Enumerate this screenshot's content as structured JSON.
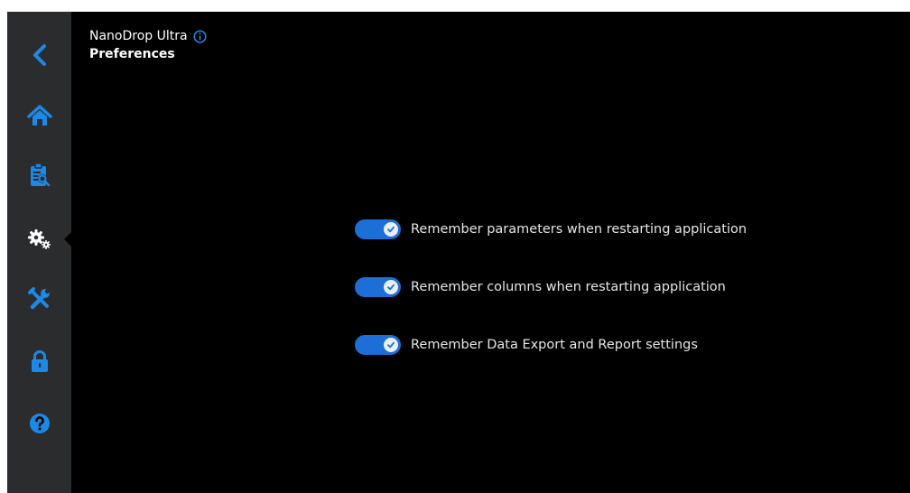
{
  "app": {
    "name": "NanoDrop Ultra",
    "page_title": "Preferences"
  },
  "sidebar": {
    "items": [
      {
        "icon": "back-arrow-icon",
        "active": false
      },
      {
        "icon": "home-icon",
        "active": false
      },
      {
        "icon": "clipboard-search-icon",
        "active": false
      },
      {
        "icon": "gears-icon",
        "active": true
      },
      {
        "icon": "tools-icon",
        "active": false
      },
      {
        "icon": "lock-icon",
        "active": false
      },
      {
        "icon": "help-icon",
        "active": false
      }
    ]
  },
  "preferences": [
    {
      "label": "Remember parameters when restarting application",
      "enabled": true
    },
    {
      "label": "Remember columns when restarting application",
      "enabled": true
    },
    {
      "label": "Remember Data Export and Report settings",
      "enabled": true
    }
  ],
  "colors": {
    "accent": "#1b6fd6",
    "sidebar_bg": "#2b2c2e",
    "screen_bg": "#000000",
    "icon": "#1e88e5"
  }
}
